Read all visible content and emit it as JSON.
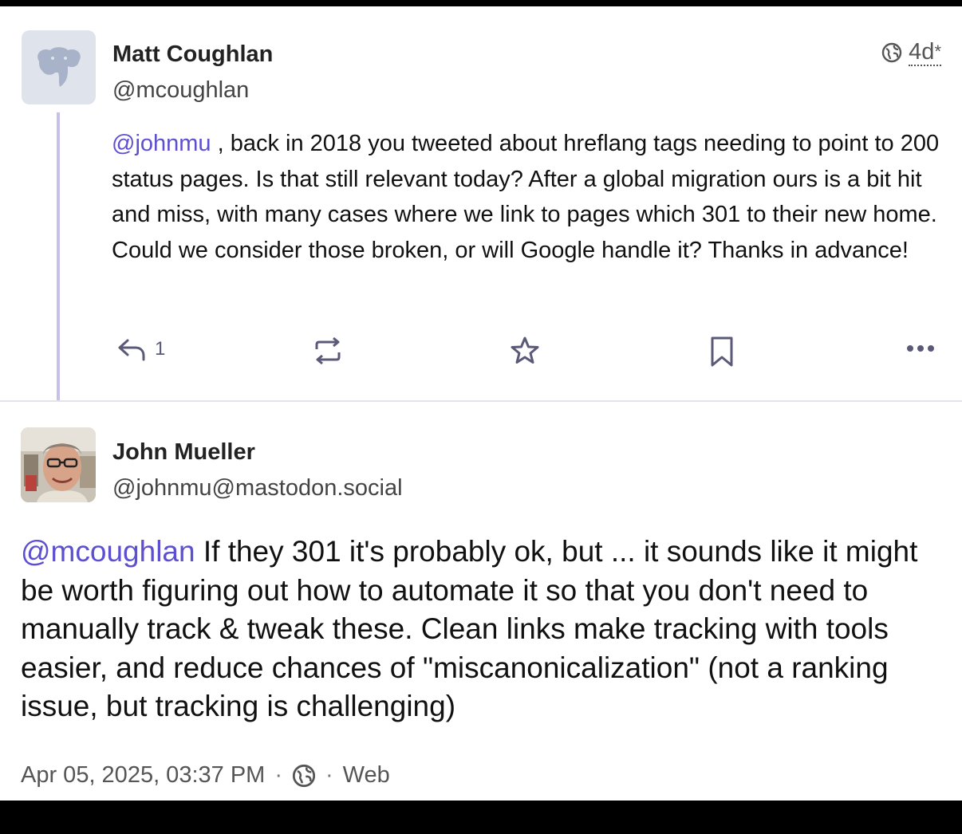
{
  "original_post": {
    "author_name": "Matt Coughlan",
    "author_handle": "@mcoughlan",
    "age": "4d",
    "edited_marker": "*",
    "visibility_icon": "globe-icon",
    "mention": "@johnmu",
    "text": " , back in 2018 you tweeted about hreflang tags needing to point to 200 status pages. Is that still relevant today? After a global migration ours is a bit hit and miss, with many cases where we link to pages which 301 to their new home. Could we consider those broken, or will Google handle it? Thanks in advance!",
    "reply_count": "1",
    "actions": [
      "reply-icon",
      "boost-icon",
      "star-icon",
      "bookmark-icon",
      "more-icon"
    ]
  },
  "reply_post": {
    "author_name": "John Mueller",
    "author_handle": "@johnmu@mastodon.social",
    "mention": "@mcoughlan",
    "text": " If they 301 it's probably ok, but ... it  sounds like it might be worth figuring out how to automate it so that you don't need to manually track & tweak these. Clean links make tracking with tools easier, and reduce chances of \"miscanonicalization\" (not a ranking issue, but tracking is challenging)",
    "timestamp": "Apr 05, 2025, 03:37 PM",
    "separator": "·",
    "client": "Web",
    "visibility_icon": "globe-icon"
  },
  "colors": {
    "mention": "#5c4fd1",
    "thread_line": "#c7c1ea",
    "action_icon": "#5a5a78"
  }
}
